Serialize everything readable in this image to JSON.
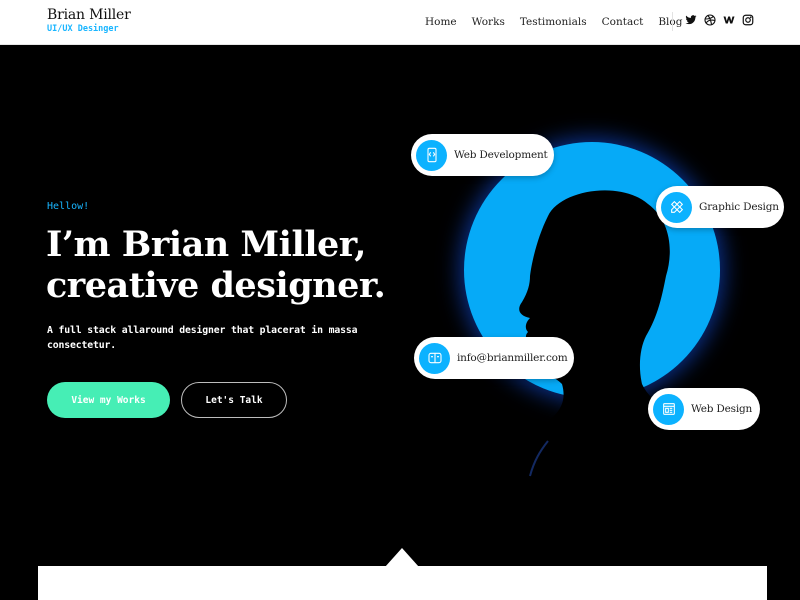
{
  "header": {
    "brand_name": "Brian Miller",
    "brand_tagline": "UI/UX Desinger",
    "nav": [
      {
        "label": "Home"
      },
      {
        "label": "Works"
      },
      {
        "label": "Testimonials"
      },
      {
        "label": "Contact"
      },
      {
        "label": "Blog"
      }
    ],
    "social": [
      {
        "icon": "twitter-icon"
      },
      {
        "icon": "dribbble-icon"
      },
      {
        "icon": "webflow-icon"
      },
      {
        "icon": "instagram-icon"
      }
    ]
  },
  "hero": {
    "greeting": "Hellow!",
    "headline_line1": "I’m Brian Miller,",
    "headline_line2": "creative designer.",
    "description": "A full stack allaround designer that placerat in massa consectetur.",
    "primary_button": "View my Works",
    "secondary_button": "Let's Talk",
    "skills": [
      {
        "label": "Web Development",
        "icon": "code-device-icon"
      },
      {
        "label": "Graphic Design",
        "icon": "pencil-ruler-icon"
      },
      {
        "label": "info@brianmiller.com",
        "icon": "mail-card-icon"
      },
      {
        "label": "Web Design",
        "icon": "browser-layout-icon"
      }
    ]
  },
  "colors": {
    "accent_blue": "#19b5ff",
    "accent_green": "#46eeb5",
    "background": "#000000"
  }
}
